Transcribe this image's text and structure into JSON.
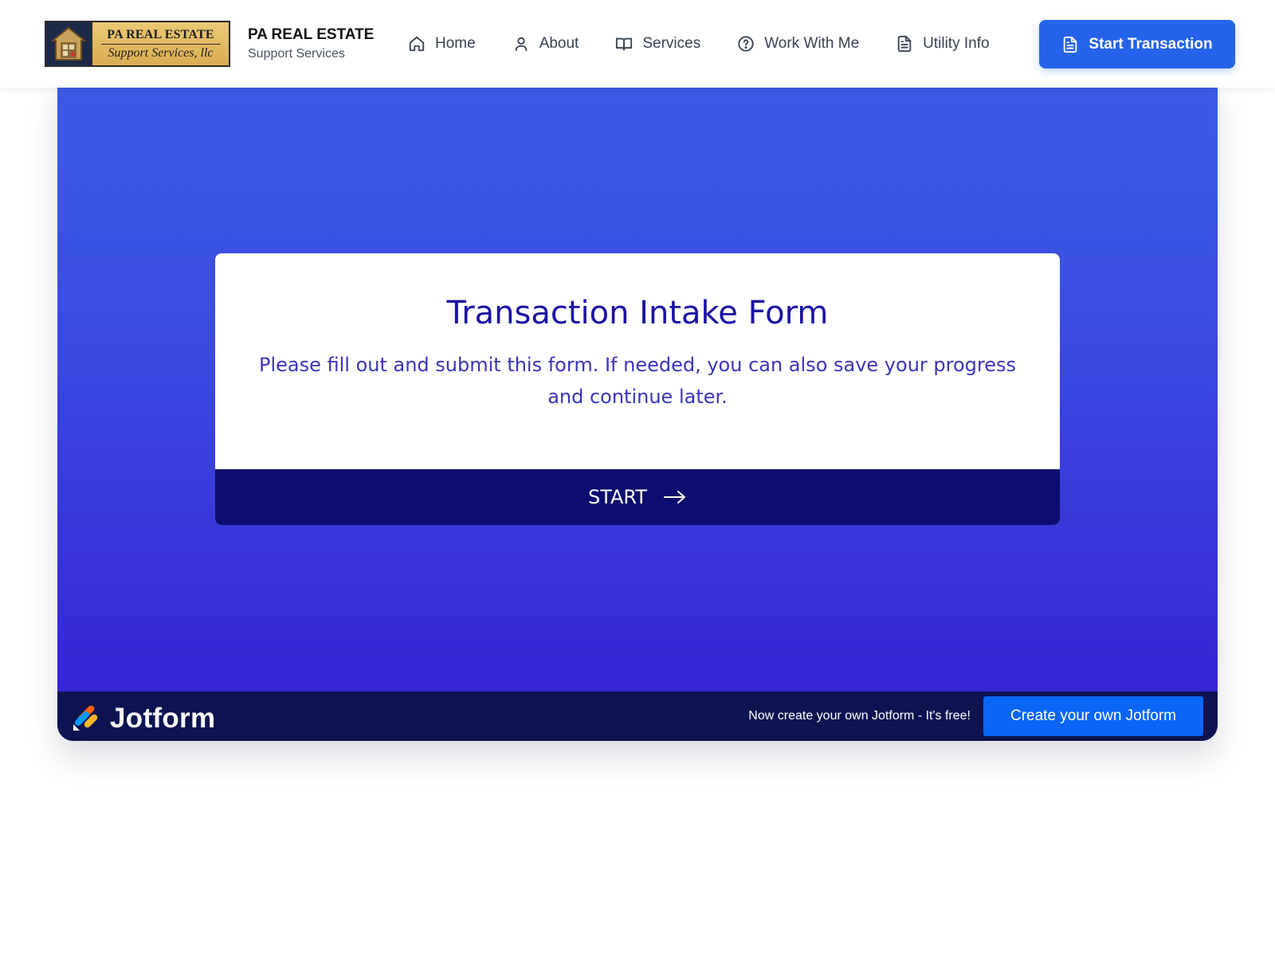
{
  "header": {
    "logo": {
      "line1": "PA REAL ESTATE",
      "line2": "Support Services, llc"
    },
    "brand_title": "PA REAL ESTATE",
    "brand_subtitle": "Support Services",
    "nav": [
      {
        "label": "Home",
        "icon": "home-icon"
      },
      {
        "label": "About",
        "icon": "user-icon"
      },
      {
        "label": "Services",
        "icon": "book-icon"
      },
      {
        "label": "Work With Me",
        "icon": "question-circle-icon"
      },
      {
        "label": "Utility Info",
        "icon": "document-icon"
      }
    ],
    "cta_label": "Start Transaction",
    "cta_icon": "document-icon"
  },
  "form": {
    "title": "Transaction Intake Form",
    "description": "Please fill out and submit this form. If needed, you can also save your progress and continue later.",
    "start_label": "START",
    "start_icon": "arrow-right-icon"
  },
  "jotform_bar": {
    "brand": "Jotform",
    "promo": "Now create your own Jotform - It's free!",
    "create_label": "Create your own Jotform"
  },
  "colors": {
    "cta_blue": "#2563eb",
    "gradient_top": "#3b5ce4",
    "gradient_bottom": "#3620d2",
    "form_title": "#1a12a3",
    "start_button": "#0b0c6e",
    "jotform_bar": "#0c1350",
    "jotform_button": "#0a66f5"
  }
}
